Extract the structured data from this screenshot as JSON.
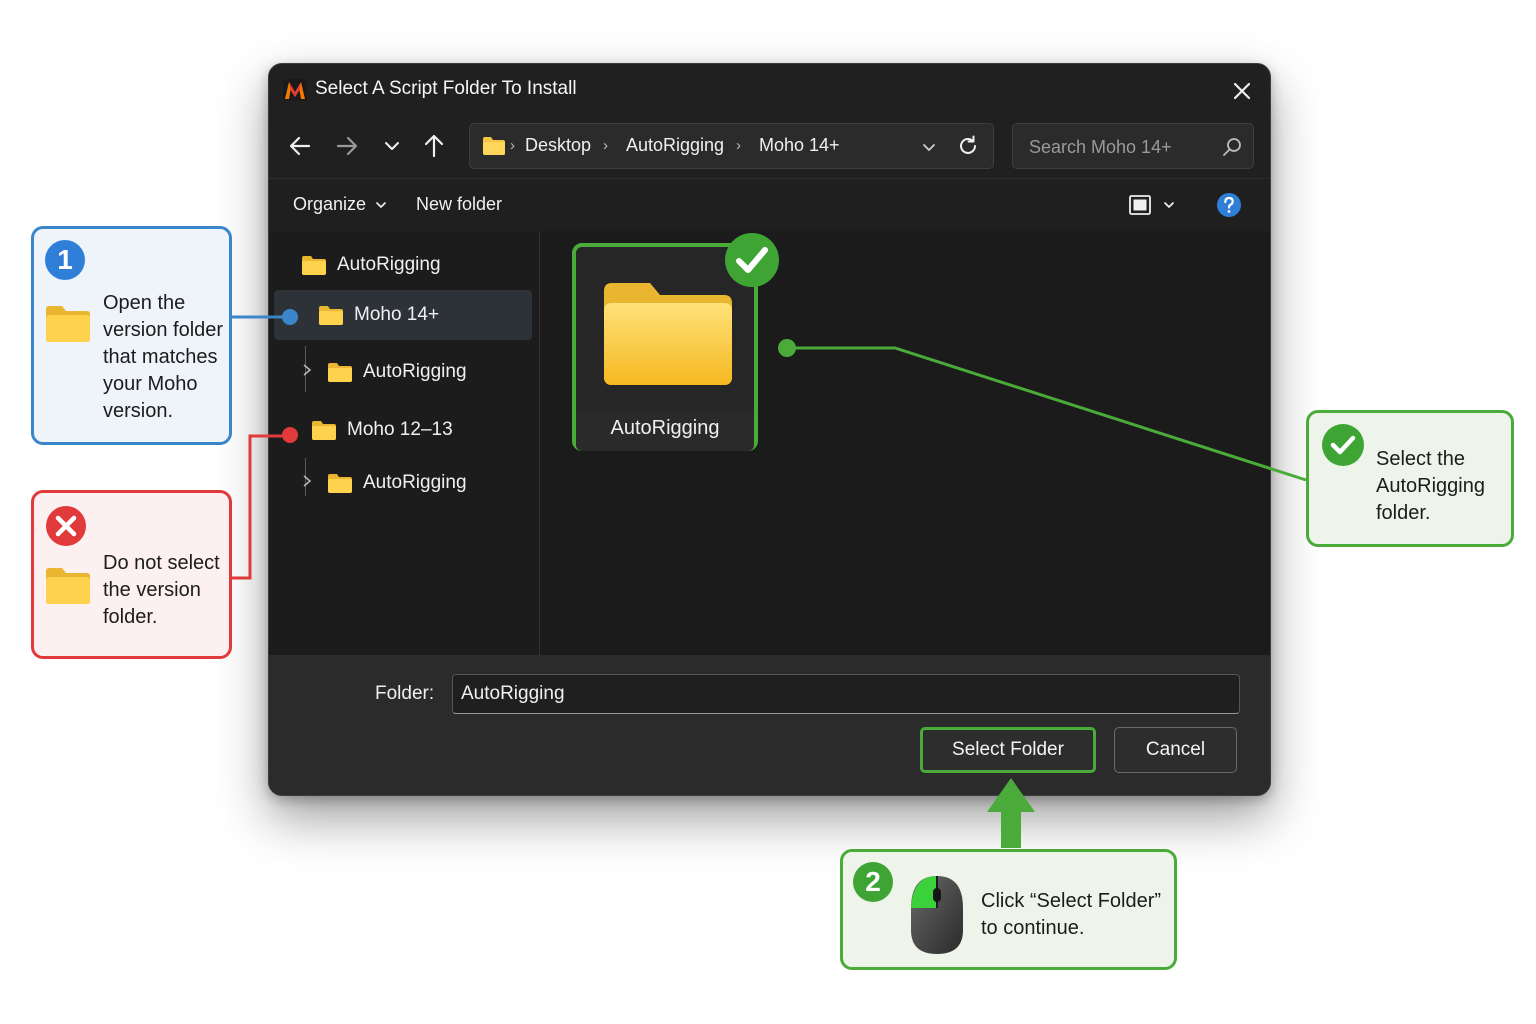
{
  "dialog": {
    "title": "Select A Script Folder To Install",
    "address": {
      "crumbs": [
        "Desktop",
        "AutoRigging",
        "Moho 14+"
      ]
    },
    "search": {
      "placeholder": "Search Moho 14+"
    },
    "toolbar": {
      "organize_label": "Organize",
      "new_folder_label": "New folder"
    },
    "nav_tree": [
      {
        "label": "AutoRigging"
      },
      {
        "label": "Moho 14+"
      },
      {
        "label": "AutoRigging"
      },
      {
        "label": "Moho 12–13"
      },
      {
        "label": "AutoRigging"
      }
    ],
    "content": {
      "selected_item_label": "AutoRigging"
    },
    "footer": {
      "folder_label": "Folder:",
      "folder_value": "AutoRigging",
      "select_button_label": "Select Folder",
      "cancel_button_label": "Cancel"
    }
  },
  "callouts": {
    "step1": {
      "badge": "1",
      "text": "Open the version folder that matches your Moho version.",
      "color": "#3a86c8"
    },
    "warning": {
      "text": "Do not select the version folder.",
      "color": "#e03a3a"
    },
    "select_hint": {
      "text": "Select the AutoRigging folder.",
      "color": "#4aab3a"
    },
    "step2": {
      "badge": "2",
      "text": "Click “Select Folder” to continue.",
      "color": "#4aab3a"
    }
  },
  "icons": [
    "moho-logo-icon",
    "close-icon",
    "back-arrow-icon",
    "forward-arrow-icon",
    "chevron-down-icon",
    "up-arrow-icon",
    "folder-icon",
    "refresh-icon",
    "search-icon",
    "view-layout-icon",
    "help-icon",
    "checkmark-icon",
    "error-x-icon",
    "mouse-icon",
    "up-arrow-pointer-icon"
  ]
}
